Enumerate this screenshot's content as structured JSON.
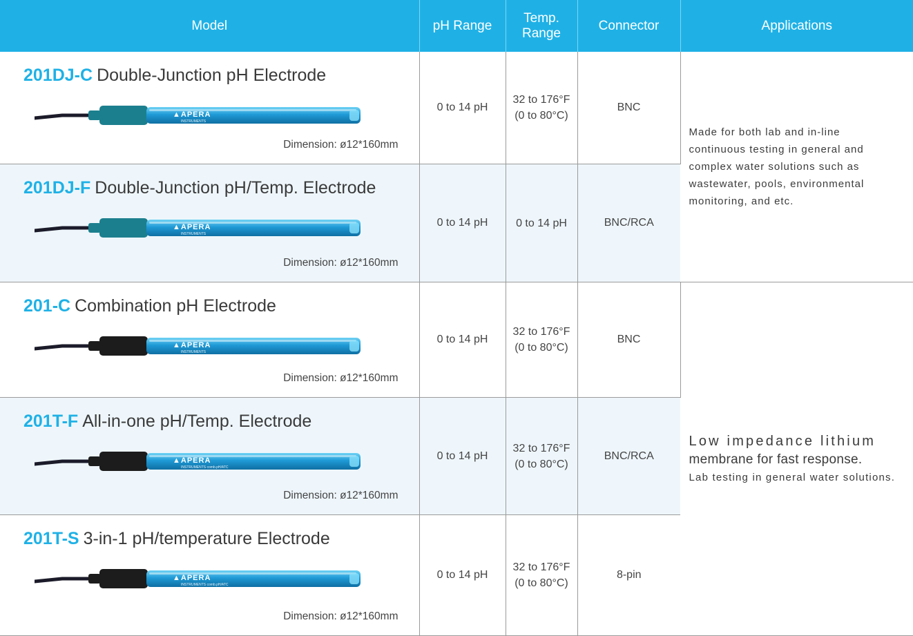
{
  "header": {
    "model": "Model",
    "ph_range": "pH Range",
    "temp_range": "Temp.\nRange",
    "connector": "Connector",
    "applications": "Applications"
  },
  "rows": [
    {
      "code": "201DJ-C",
      "name": "Double-Junction pH Electrode",
      "dimension": "Dimension: ø12*160mm",
      "ph_range": "0 to 14 pH",
      "temp_range": "32 to 176°F\n(0 to 80°C)",
      "connector": "BNC",
      "probe": {
        "cap_color": "#1c7f8e",
        "body_color": "#1f9ad6",
        "label": "APERA",
        "sublabel": "INSTRUMENTS"
      }
    },
    {
      "code": "201DJ-F",
      "name": "Double-Junction pH/Temp. Electrode",
      "dimension": "Dimension: ø12*160mm",
      "ph_range": "0 to 14 pH",
      "temp_range": "0 to 14 pH",
      "connector": "BNC/RCA",
      "probe": {
        "cap_color": "#1c7f8e",
        "body_color": "#1f9ad6",
        "label": "APERA",
        "sublabel": "INSTRUMENTS"
      }
    },
    {
      "code": "201-C",
      "name": "Combination pH Electrode",
      "dimension": "Dimension: ø12*160mm",
      "ph_range": "0 to 14 pH",
      "temp_range": "32 to 176°F\n(0 to 80°C)",
      "connector": "BNC",
      "probe": {
        "cap_color": "#1c1c1c",
        "body_color": "#1f9ad6",
        "label": "APERA",
        "sublabel": "INSTRUMENTS"
      }
    },
    {
      "code": "201T-F",
      "name": "All-in-one pH/Temp. Electrode",
      "dimension": "Dimension: ø12*160mm",
      "ph_range": "0 to 14 pH",
      "temp_range": "32 to 176°F\n(0 to 80°C)",
      "connector": "BNC/RCA",
      "probe": {
        "cap_color": "#1c1c1c",
        "body_color": "#1f9ad6",
        "label": "APERA",
        "sublabel": "INSTRUMENTS comb.pH/ATC"
      }
    },
    {
      "code": "201T-S",
      "name": "3-in-1 pH/temperature Electrode",
      "dimension": "Dimension: ø12*160mm",
      "ph_range": "0 to 14 pH",
      "temp_range": "32 to 176°F\n(0 to 80°C)",
      "connector": "8-pin",
      "probe": {
        "cap_color": "#1c1c1c",
        "body_color": "#1f9ad6",
        "label": "APERA",
        "sublabel": "INSTRUMENTS comb.pH/ATC"
      }
    }
  ],
  "applications": {
    "group1": "Made for both lab and in-line continuous testing in general and complex water solutions such as wastewater, pools, environmental monitoring, and etc.",
    "group2_line1": "Low impedance lithium",
    "group2_line2": "membrane for fast response.",
    "group2_line3": "Lab testing in general water solutions."
  },
  "colors": {
    "header_bg": "#1fb1e6",
    "model_code": "#1fb1e6",
    "alt_row_bg": "#eef6fb"
  }
}
